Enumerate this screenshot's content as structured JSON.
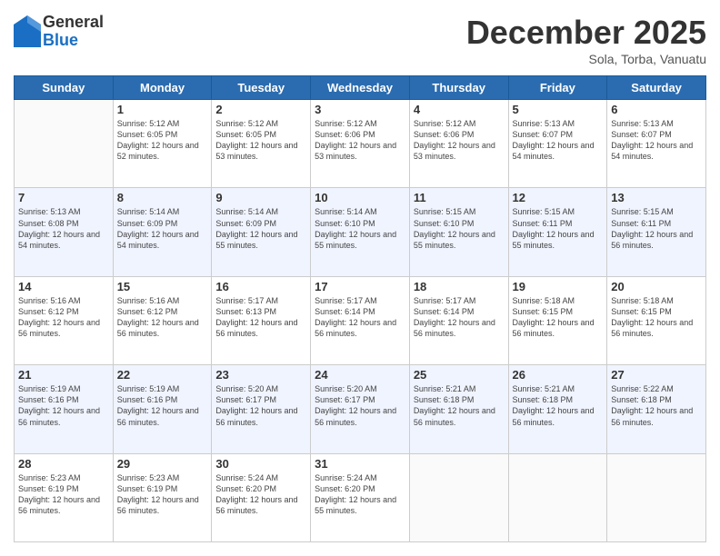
{
  "logo": {
    "general": "General",
    "blue": "Blue"
  },
  "header": {
    "month": "December 2025",
    "location": "Sola, Torba, Vanuatu"
  },
  "weekdays": [
    "Sunday",
    "Monday",
    "Tuesday",
    "Wednesday",
    "Thursday",
    "Friday",
    "Saturday"
  ],
  "weeks": [
    [
      {
        "day": "",
        "sunrise": "",
        "sunset": "",
        "daylight": ""
      },
      {
        "day": "1",
        "sunrise": "Sunrise: 5:12 AM",
        "sunset": "Sunset: 6:05 PM",
        "daylight": "Daylight: 12 hours and 52 minutes."
      },
      {
        "day": "2",
        "sunrise": "Sunrise: 5:12 AM",
        "sunset": "Sunset: 6:05 PM",
        "daylight": "Daylight: 12 hours and 53 minutes."
      },
      {
        "day": "3",
        "sunrise": "Sunrise: 5:12 AM",
        "sunset": "Sunset: 6:06 PM",
        "daylight": "Daylight: 12 hours and 53 minutes."
      },
      {
        "day": "4",
        "sunrise": "Sunrise: 5:12 AM",
        "sunset": "Sunset: 6:06 PM",
        "daylight": "Daylight: 12 hours and 53 minutes."
      },
      {
        "day": "5",
        "sunrise": "Sunrise: 5:13 AM",
        "sunset": "Sunset: 6:07 PM",
        "daylight": "Daylight: 12 hours and 54 minutes."
      },
      {
        "day": "6",
        "sunrise": "Sunrise: 5:13 AM",
        "sunset": "Sunset: 6:07 PM",
        "daylight": "Daylight: 12 hours and 54 minutes."
      }
    ],
    [
      {
        "day": "7",
        "sunrise": "Sunrise: 5:13 AM",
        "sunset": "Sunset: 6:08 PM",
        "daylight": "Daylight: 12 hours and 54 minutes."
      },
      {
        "day": "8",
        "sunrise": "Sunrise: 5:14 AM",
        "sunset": "Sunset: 6:09 PM",
        "daylight": "Daylight: 12 hours and 54 minutes."
      },
      {
        "day": "9",
        "sunrise": "Sunrise: 5:14 AM",
        "sunset": "Sunset: 6:09 PM",
        "daylight": "Daylight: 12 hours and 55 minutes."
      },
      {
        "day": "10",
        "sunrise": "Sunrise: 5:14 AM",
        "sunset": "Sunset: 6:10 PM",
        "daylight": "Daylight: 12 hours and 55 minutes."
      },
      {
        "day": "11",
        "sunrise": "Sunrise: 5:15 AM",
        "sunset": "Sunset: 6:10 PM",
        "daylight": "Daylight: 12 hours and 55 minutes."
      },
      {
        "day": "12",
        "sunrise": "Sunrise: 5:15 AM",
        "sunset": "Sunset: 6:11 PM",
        "daylight": "Daylight: 12 hours and 55 minutes."
      },
      {
        "day": "13",
        "sunrise": "Sunrise: 5:15 AM",
        "sunset": "Sunset: 6:11 PM",
        "daylight": "Daylight: 12 hours and 56 minutes."
      }
    ],
    [
      {
        "day": "14",
        "sunrise": "Sunrise: 5:16 AM",
        "sunset": "Sunset: 6:12 PM",
        "daylight": "Daylight: 12 hours and 56 minutes."
      },
      {
        "day": "15",
        "sunrise": "Sunrise: 5:16 AM",
        "sunset": "Sunset: 6:12 PM",
        "daylight": "Daylight: 12 hours and 56 minutes."
      },
      {
        "day": "16",
        "sunrise": "Sunrise: 5:17 AM",
        "sunset": "Sunset: 6:13 PM",
        "daylight": "Daylight: 12 hours and 56 minutes."
      },
      {
        "day": "17",
        "sunrise": "Sunrise: 5:17 AM",
        "sunset": "Sunset: 6:14 PM",
        "daylight": "Daylight: 12 hours and 56 minutes."
      },
      {
        "day": "18",
        "sunrise": "Sunrise: 5:17 AM",
        "sunset": "Sunset: 6:14 PM",
        "daylight": "Daylight: 12 hours and 56 minutes."
      },
      {
        "day": "19",
        "sunrise": "Sunrise: 5:18 AM",
        "sunset": "Sunset: 6:15 PM",
        "daylight": "Daylight: 12 hours and 56 minutes."
      },
      {
        "day": "20",
        "sunrise": "Sunrise: 5:18 AM",
        "sunset": "Sunset: 6:15 PM",
        "daylight": "Daylight: 12 hours and 56 minutes."
      }
    ],
    [
      {
        "day": "21",
        "sunrise": "Sunrise: 5:19 AM",
        "sunset": "Sunset: 6:16 PM",
        "daylight": "Daylight: 12 hours and 56 minutes."
      },
      {
        "day": "22",
        "sunrise": "Sunrise: 5:19 AM",
        "sunset": "Sunset: 6:16 PM",
        "daylight": "Daylight: 12 hours and 56 minutes."
      },
      {
        "day": "23",
        "sunrise": "Sunrise: 5:20 AM",
        "sunset": "Sunset: 6:17 PM",
        "daylight": "Daylight: 12 hours and 56 minutes."
      },
      {
        "day": "24",
        "sunrise": "Sunrise: 5:20 AM",
        "sunset": "Sunset: 6:17 PM",
        "daylight": "Daylight: 12 hours and 56 minutes."
      },
      {
        "day": "25",
        "sunrise": "Sunrise: 5:21 AM",
        "sunset": "Sunset: 6:18 PM",
        "daylight": "Daylight: 12 hours and 56 minutes."
      },
      {
        "day": "26",
        "sunrise": "Sunrise: 5:21 AM",
        "sunset": "Sunset: 6:18 PM",
        "daylight": "Daylight: 12 hours and 56 minutes."
      },
      {
        "day": "27",
        "sunrise": "Sunrise: 5:22 AM",
        "sunset": "Sunset: 6:18 PM",
        "daylight": "Daylight: 12 hours and 56 minutes."
      }
    ],
    [
      {
        "day": "28",
        "sunrise": "Sunrise: 5:23 AM",
        "sunset": "Sunset: 6:19 PM",
        "daylight": "Daylight: 12 hours and 56 minutes."
      },
      {
        "day": "29",
        "sunrise": "Sunrise: 5:23 AM",
        "sunset": "Sunset: 6:19 PM",
        "daylight": "Daylight: 12 hours and 56 minutes."
      },
      {
        "day": "30",
        "sunrise": "Sunrise: 5:24 AM",
        "sunset": "Sunset: 6:20 PM",
        "daylight": "Daylight: 12 hours and 56 minutes."
      },
      {
        "day": "31",
        "sunrise": "Sunrise: 5:24 AM",
        "sunset": "Sunset: 6:20 PM",
        "daylight": "Daylight: 12 hours and 55 minutes."
      },
      {
        "day": "",
        "sunrise": "",
        "sunset": "",
        "daylight": ""
      },
      {
        "day": "",
        "sunrise": "",
        "sunset": "",
        "daylight": ""
      },
      {
        "day": "",
        "sunrise": "",
        "sunset": "",
        "daylight": ""
      }
    ]
  ]
}
